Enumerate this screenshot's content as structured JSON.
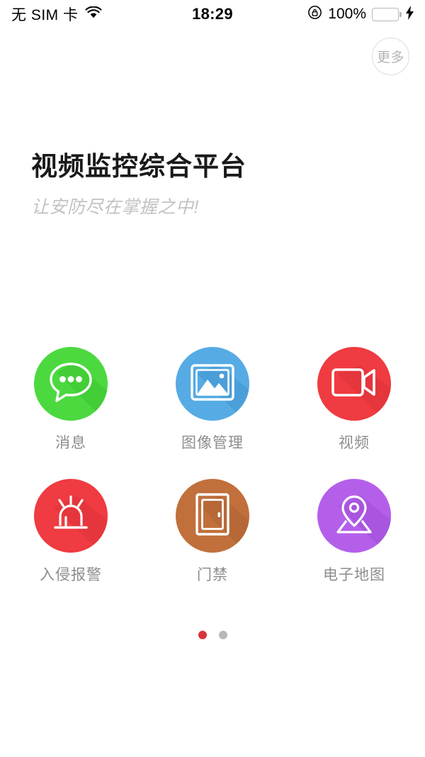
{
  "status_bar": {
    "carrier": "无 SIM 卡",
    "wifi_icon": "wifi-icon",
    "time": "18:29",
    "rotation_lock_icon": "rotation-lock-icon",
    "battery_percent": "100%",
    "battery_icon": "battery-icon",
    "charging_icon": "charging-bolt-icon",
    "battery_color": "#4cd964"
  },
  "header": {
    "more_label": "更多",
    "more_icon": "more-button-icon"
  },
  "hero": {
    "title": "视频监控综合平台",
    "subtitle": "让安防尽在掌握之中!"
  },
  "grid": {
    "rows": [
      [
        {
          "label": "消息",
          "icon": "message-bubble-icon",
          "color": "#4cd93f",
          "shadow_color": "#3cc331"
        },
        {
          "label": "图像管理",
          "icon": "photo-picture-icon",
          "color": "#56abe4",
          "shadow_color": "#4396cf"
        },
        {
          "label": "视频",
          "icon": "video-camera-icon",
          "color": "#ef3b41",
          "shadow_color": "#d93138"
        }
      ],
      [
        {
          "label": "入侵报警",
          "icon": "alarm-siren-icon",
          "color": "#ef3b41",
          "shadow_color": "#d93138"
        },
        {
          "label": "门禁",
          "icon": "door-access-icon",
          "color": "#c1703c",
          "shadow_color": "#a85f31"
        },
        {
          "label": "电子地图",
          "icon": "map-pin-icon",
          "color": "#b45fea",
          "shadow_color": "#9e4bd4"
        }
      ]
    ]
  },
  "pager": {
    "total": 2,
    "active_index": 0,
    "active_color": "#d8333c",
    "inactive_color": "#b7b7b7"
  }
}
